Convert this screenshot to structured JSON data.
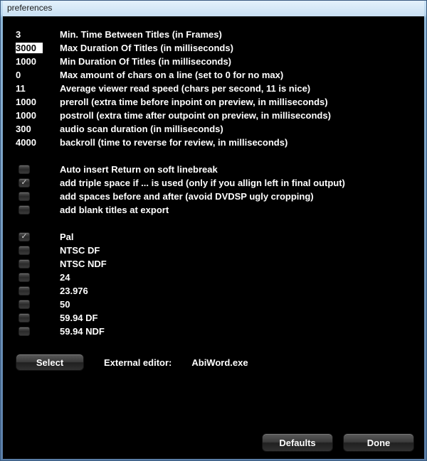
{
  "window": {
    "title": "preferences"
  },
  "numeric": [
    {
      "value": "3",
      "selected": false,
      "label": "Min. Time Between Titles (in Frames)"
    },
    {
      "value": "3000",
      "selected": true,
      "label": "Max Duration Of Titles (in milliseconds)"
    },
    {
      "value": "1000",
      "selected": false,
      "label": "Min Duration Of Titles (in milliseconds)"
    },
    {
      "value": "0",
      "selected": false,
      "label": "Max amount of chars on a line (set to 0 for no max)"
    },
    {
      "value": "11",
      "selected": false,
      "label": "Average viewer read speed (chars per second, 11 is nice)"
    },
    {
      "value": "1000",
      "selected": false,
      "label": "preroll (extra time before inpoint on preview, in milliseconds)"
    },
    {
      "value": "1000",
      "selected": false,
      "label": "postroll (extra time after outpoint on preview, in milliseconds)"
    },
    {
      "value": "300",
      "selected": false,
      "label": "audio scan duration (in milliseconds)"
    },
    {
      "value": "4000",
      "selected": false,
      "label": "backroll (time to reverse for review, in milliseconds)"
    }
  ],
  "options": [
    {
      "checked": false,
      "label": "Auto insert Return on soft linebreak"
    },
    {
      "checked": true,
      "label": "add triple space if ... is used (only if you allign left in final output)"
    },
    {
      "checked": false,
      "label": "add spaces before and after (avoid DVDSP ugly cropping)"
    },
    {
      "checked": false,
      "label": "add blank titles at export"
    }
  ],
  "formats": [
    {
      "checked": true,
      "label": "Pal"
    },
    {
      "checked": false,
      "label": "NTSC DF"
    },
    {
      "checked": false,
      "label": "NTSC NDF"
    },
    {
      "checked": false,
      "label": "24"
    },
    {
      "checked": false,
      "label": "23.976"
    },
    {
      "checked": false,
      "label": "50"
    },
    {
      "checked": false,
      "label": "59.94 DF"
    },
    {
      "checked": false,
      "label": "59.94 NDF"
    }
  ],
  "external_editor": {
    "select_label": "Select",
    "label": "External editor:",
    "value": "AbiWord.exe"
  },
  "buttons": {
    "defaults": "Defaults",
    "done": "Done"
  }
}
